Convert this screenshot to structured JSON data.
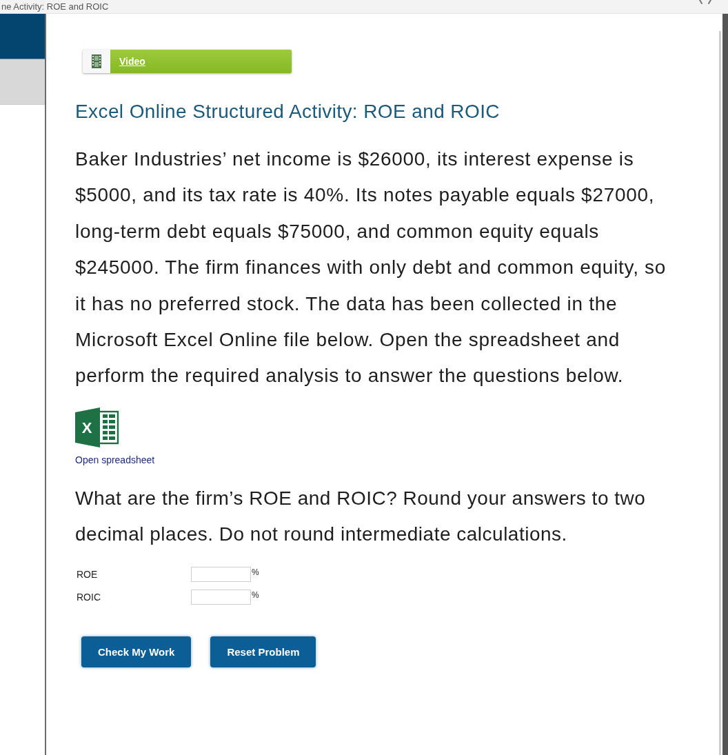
{
  "window": {
    "title": "ne Activity: ROE and ROIC"
  },
  "sidebar": {
    "items": [
      {
        "selected": true
      },
      {
        "selected": false
      }
    ]
  },
  "video_button": {
    "label": "Video"
  },
  "title": "Excel Online Structured Activity: ROE and ROIC",
  "problem_text": "Baker Industries’ net income is $26000, its interest expense is $5000, and its tax rate is 40%. Its notes payable equals $27000, long-term debt equals $75000, and common equity equals $245000. The firm finances with only debt and common equity, so it has no preferred stock. The data has been collected in the Microsoft Excel Online file below. Open the spreadsheet and perform the required analysis to answer the questions below.",
  "spreadsheet": {
    "icon_letter": "X",
    "link": "Open spreadsheet"
  },
  "question": "What are the firm’s ROE and ROIC? Round your answers to two decimal places. Do not round intermediate calculations.",
  "answers": [
    {
      "label": "ROE",
      "unit": "%"
    },
    {
      "label": "ROIC",
      "unit": "%"
    }
  ],
  "buttons": [
    {
      "label": "Check My Work"
    },
    {
      "label": "Reset Problem"
    }
  ]
}
